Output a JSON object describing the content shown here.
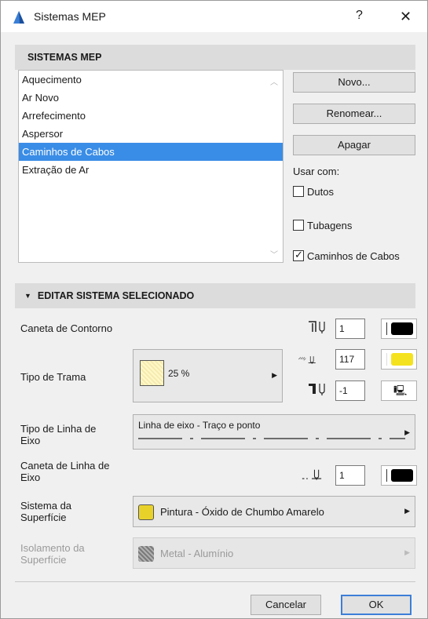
{
  "window": {
    "title": "Sistemas MEP",
    "help_label": "?",
    "close_label": "✕"
  },
  "sistemas": {
    "header": "SISTEMAS MEP",
    "items": [
      "Aquecimento",
      "Ar Novo",
      "Arrefecimento",
      "Aspersor",
      "Caminhos de Cabos",
      "Extração de Ar"
    ],
    "selected_index": 4,
    "buttons": {
      "novo": "Novo...",
      "renomear": "Renomear...",
      "apagar": "Apagar"
    },
    "usar_com": "Usar com:",
    "checks": [
      {
        "label": "Dutos",
        "checked": false
      },
      {
        "label": "Tubagens",
        "checked": false
      },
      {
        "label": "Caminhos de Cabos",
        "checked": true
      }
    ]
  },
  "editar": {
    "header": "EDITAR SISTEMA SELECIONADO",
    "caneta_contorno": {
      "label": "Caneta de Contorno",
      "value": "1",
      "color": "#000000"
    },
    "tipo_trama": {
      "label": "Tipo de Trama",
      "pattern_label": "25 %",
      "pen_fg": {
        "value": "117",
        "color": "#f5e21e"
      },
      "pen_bg": {
        "value": "-1"
      }
    },
    "tipo_linha_eixo": {
      "label": "Tipo de Linha de Eixo",
      "value": "Linha de eixo - Traço e ponto"
    },
    "caneta_linha_eixo": {
      "label": "Caneta de Linha de Eixo",
      "value": "1",
      "color": "#000000"
    },
    "sistema_superficie": {
      "label": "Sistema da Superfície",
      "value": "Pintura - Óxido de Chumbo Amarelo",
      "color": "#e8d22a"
    },
    "isolamento_superficie": {
      "label": "Isolamento da Superfície",
      "value": "Metal - Alumínio"
    }
  },
  "footer": {
    "cancel": "Cancelar",
    "ok": "OK"
  },
  "colors": {
    "selection": "#3a8de6",
    "accent": "#3c7fd8"
  }
}
